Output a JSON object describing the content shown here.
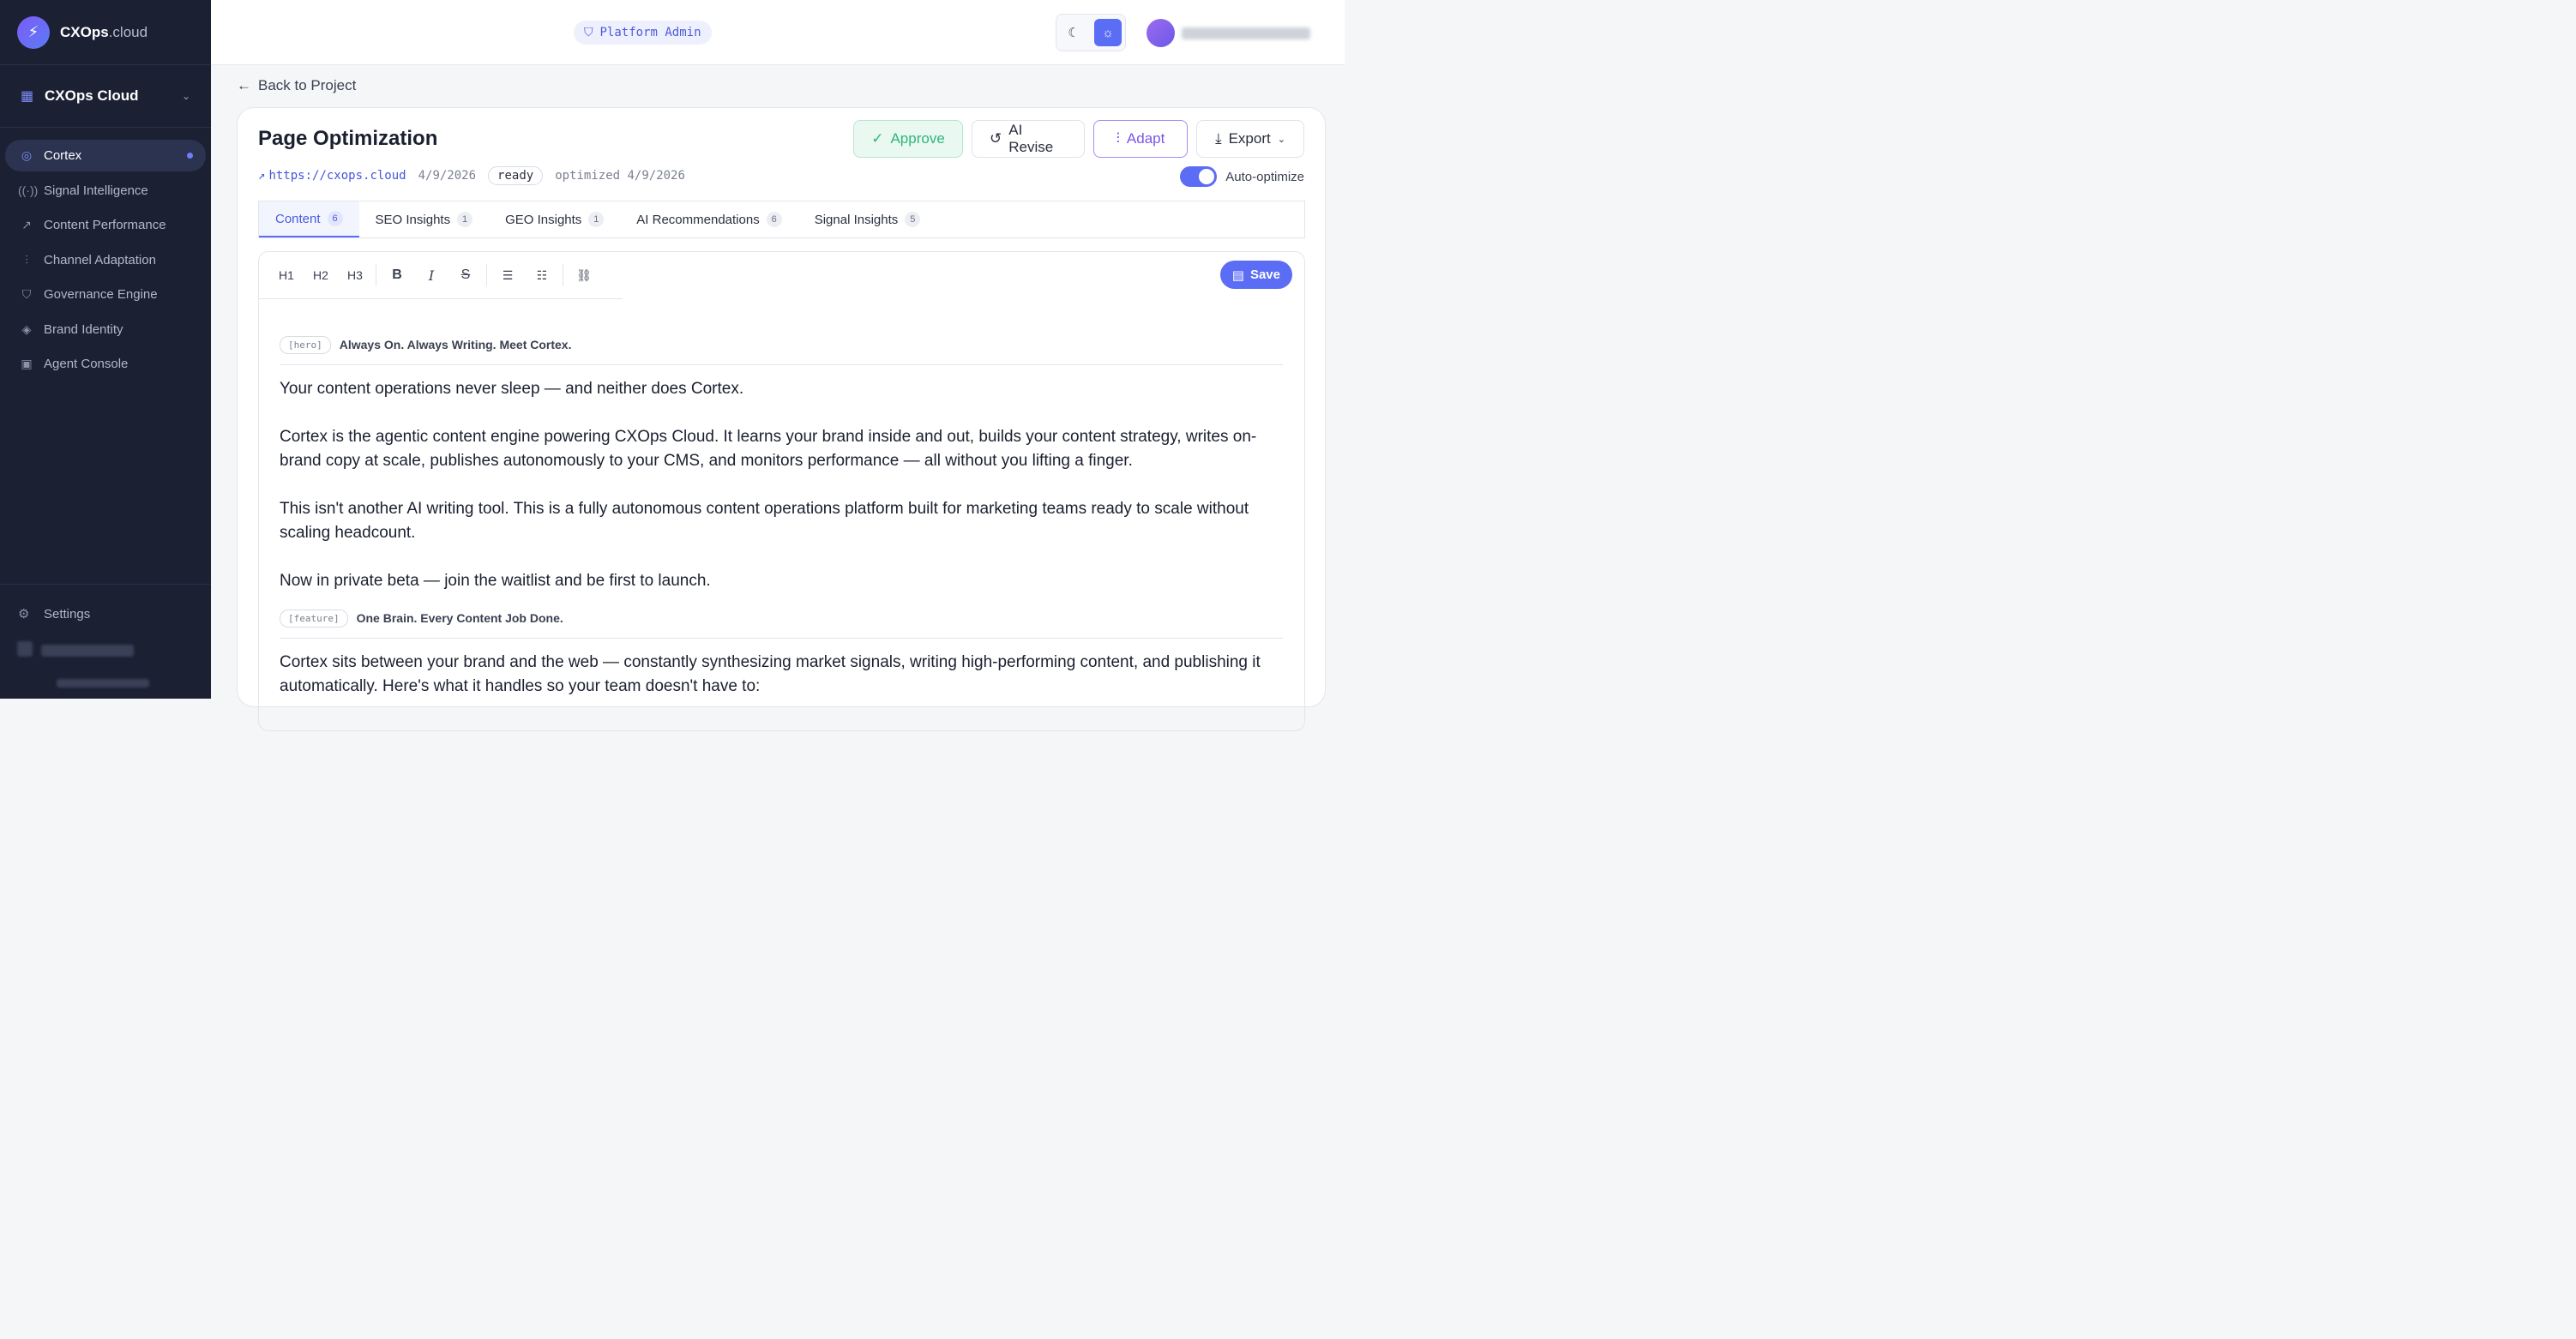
{
  "brand": {
    "name": "CXOps",
    "tld": ".cloud"
  },
  "workspace": {
    "label": "CXOps Cloud"
  },
  "nav": {
    "items": [
      {
        "label": "Cortex",
        "icon": "brain-icon",
        "active": true
      },
      {
        "label": "Signal Intelligence",
        "icon": "radio-icon"
      },
      {
        "label": "Content Performance",
        "icon": "trending-up-icon"
      },
      {
        "label": "Channel Adaptation",
        "icon": "sliders-icon"
      },
      {
        "label": "Governance Engine",
        "icon": "shield-icon"
      },
      {
        "label": "Brand Identity",
        "icon": "layers-icon"
      },
      {
        "label": "Agent Console",
        "icon": "bot-icon"
      }
    ],
    "settings_label": "Settings"
  },
  "topbar": {
    "admin_label": "Platform Admin"
  },
  "page": {
    "back_label": "Back to Project",
    "title": "Page Optimization",
    "url": "https://cxops.cloud",
    "date": "4/9/2026",
    "status": "ready",
    "optimized": "optimized 4/9/2026",
    "auto_optimize_label": "Auto-optimize",
    "auto_optimize_on": true
  },
  "actions": {
    "approve": "Approve",
    "revise": "AI Revise",
    "adapt": "Adapt",
    "export": "Export"
  },
  "tabs": [
    {
      "label": "Content",
      "count": "6"
    },
    {
      "label": "SEO Insights",
      "count": "1"
    },
    {
      "label": "GEO Insights",
      "count": "1"
    },
    {
      "label": "AI Recommendations",
      "count": "6"
    },
    {
      "label": "Signal Insights",
      "count": "5"
    }
  ],
  "editor": {
    "tools": [
      "H1",
      "H2",
      "H3"
    ],
    "save_label": "Save",
    "sections": [
      {
        "tag": "[hero]",
        "title": "Always On. Always Writing. Meet Cortex.",
        "paragraphs": [
          "Your content operations never sleep — and neither does Cortex.",
          "Cortex is the agentic content engine powering CXOps Cloud. It learns your brand inside and out, builds your content strategy, writes on-brand copy at scale, publishes autonomously to your CMS, and monitors performance — all without you lifting a finger.",
          "This isn't another AI writing tool. This is a fully autonomous content operations platform built for marketing teams ready to scale without scaling headcount.",
          "Now in private beta — join the waitlist and be first to launch."
        ]
      },
      {
        "tag": "[feature]",
        "title": "One Brain. Every Content Job Done.",
        "paragraphs": [
          "Cortex sits between your brand and the web — constantly synthesizing market signals, writing high-performing content, and publishing it automatically. Here's what it handles so your team doesn't have to:"
        ]
      }
    ]
  },
  "colors": {
    "accent": "#5b6cf5",
    "sidebar_bg": "#1b2133",
    "approve": "#2fb67a",
    "adapt": "#7b55e6"
  }
}
